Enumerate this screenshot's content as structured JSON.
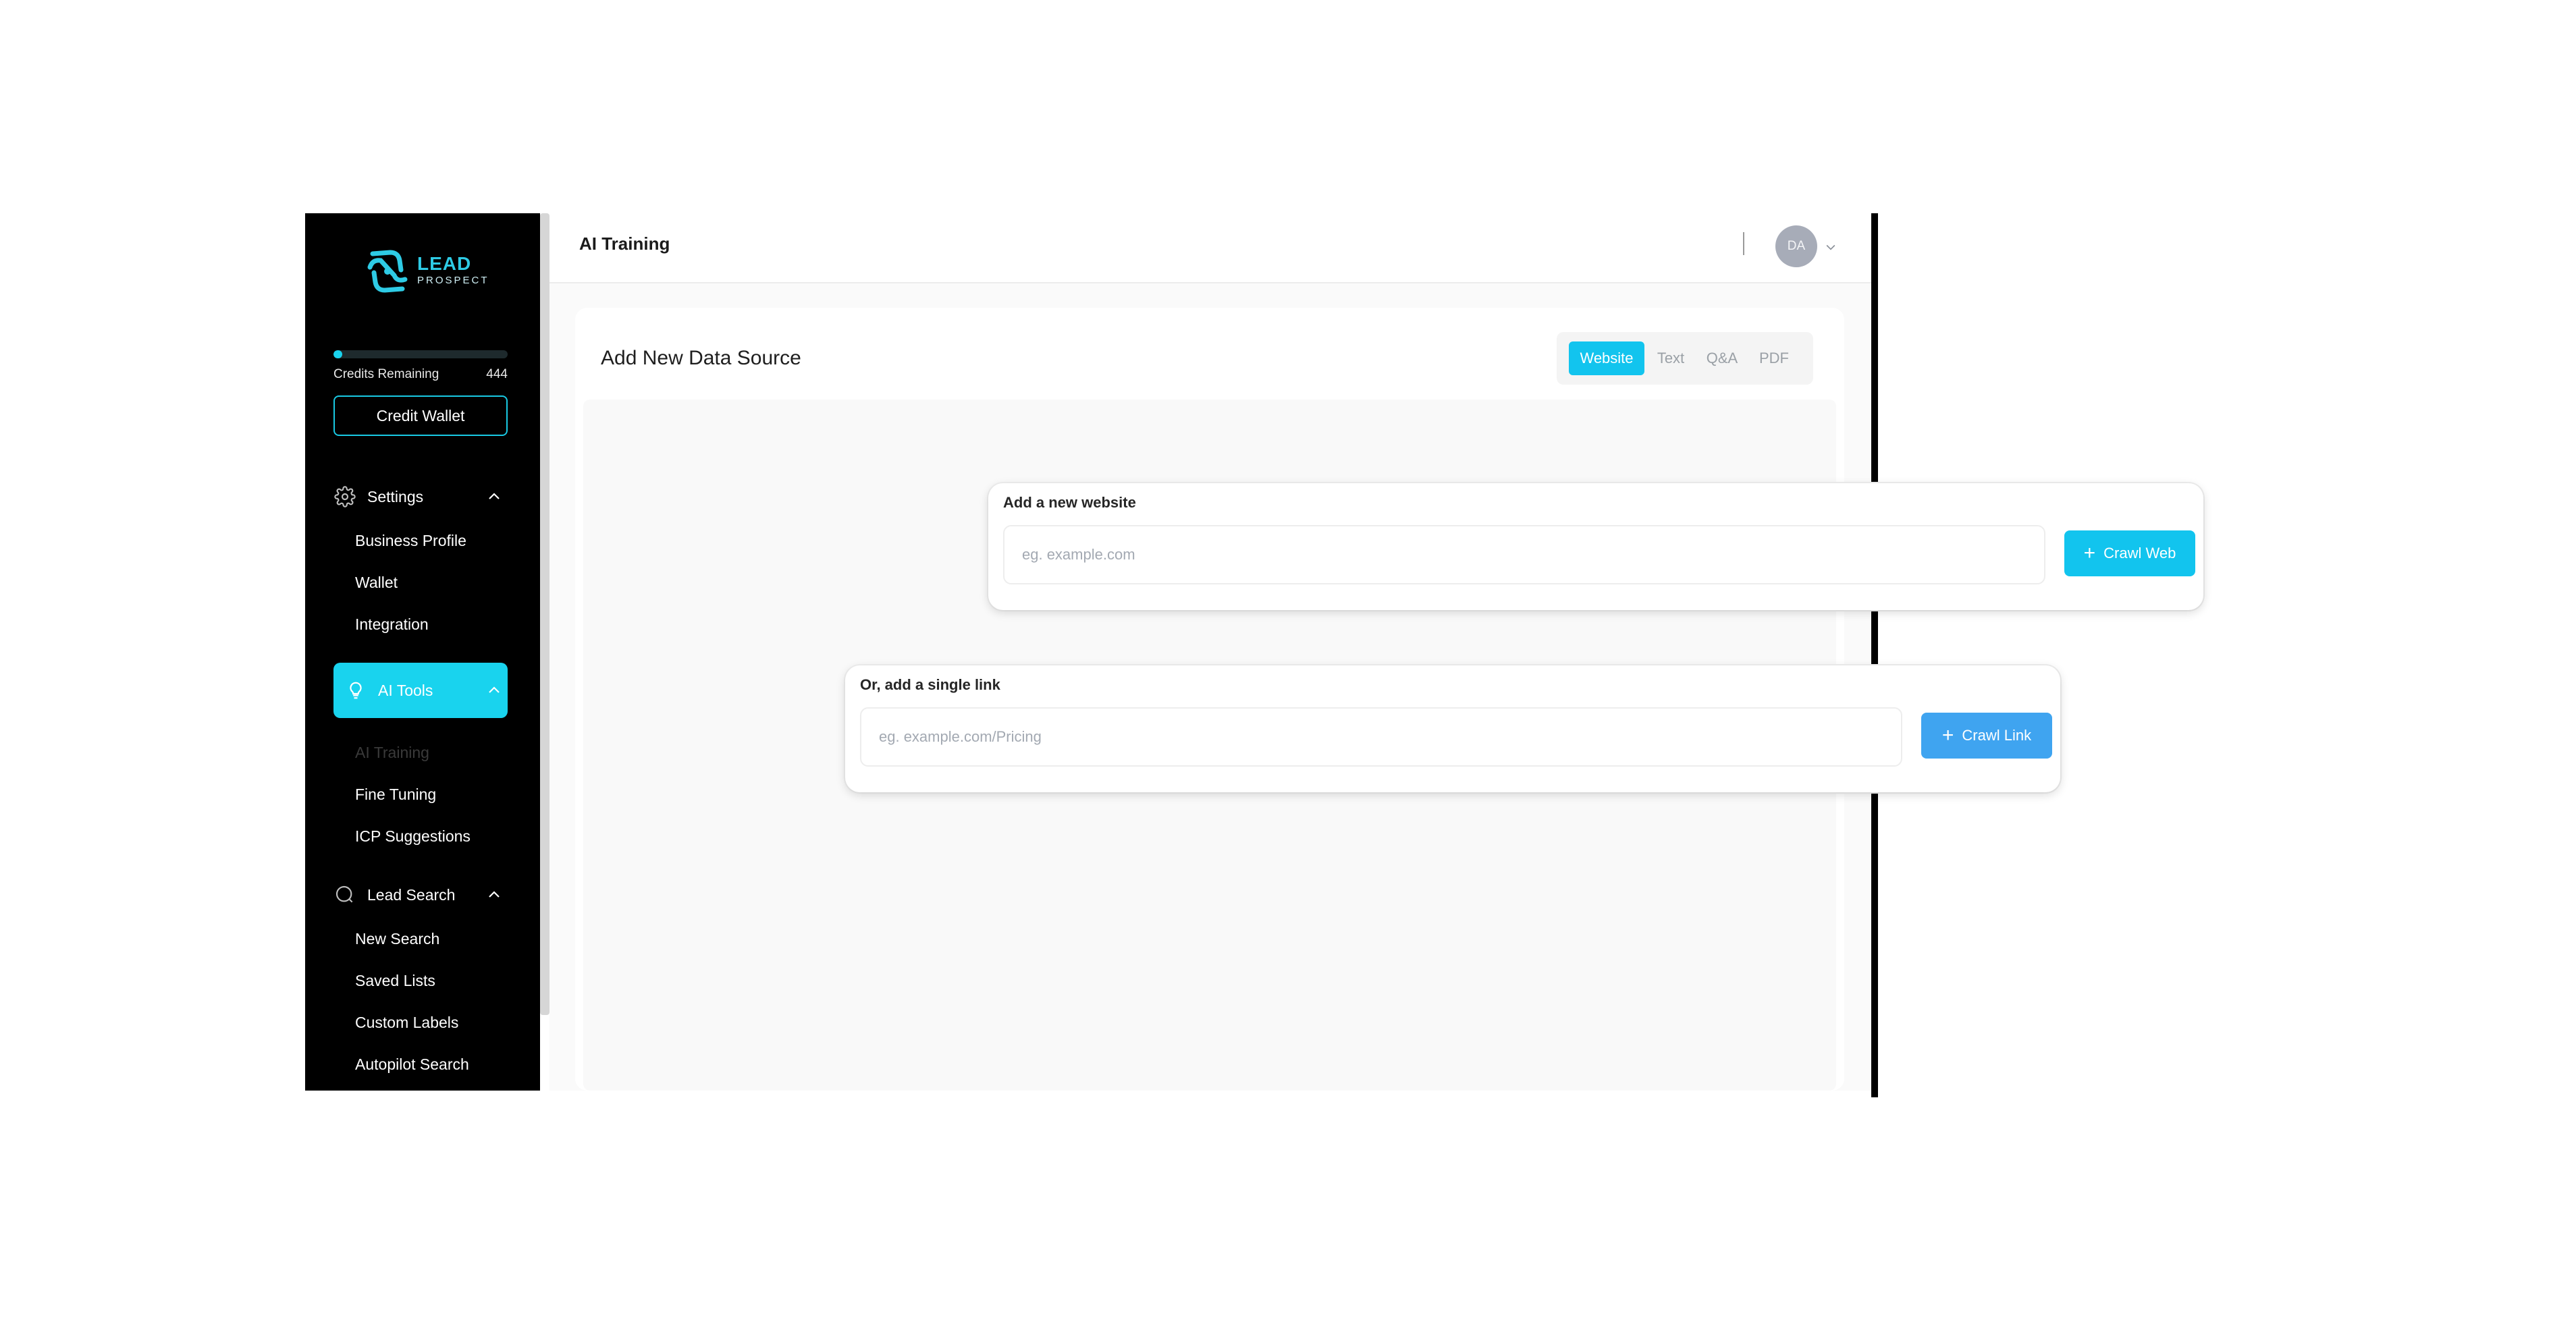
{
  "brand": {
    "name": "LEAD",
    "tagline": "PROSPECT",
    "accent": "#19d3ee"
  },
  "sidebar": {
    "credits": {
      "label": "Credits Remaining",
      "value": "444",
      "fill_fraction": 0.05
    },
    "wallet_button": "Credit Wallet",
    "sections": [
      {
        "label": "Settings",
        "icon": "gear-icon",
        "items": [
          "Business Profile",
          "Wallet",
          "Integration"
        ]
      },
      {
        "label": "AI Tools",
        "icon": "lightbulb-icon",
        "active": true,
        "items": [
          "AI Training",
          "Fine Tuning",
          "ICP Suggestions"
        ]
      },
      {
        "label": "Lead Search",
        "icon": "search-icon",
        "items": [
          "New Search",
          "Saved Lists",
          "Custom Labels",
          "Autopilot Search"
        ]
      }
    ]
  },
  "header": {
    "title": "AI Training",
    "avatar_initials": "DA"
  },
  "card": {
    "title": "Add New Data Source",
    "tabs": [
      "Website",
      "Text",
      "Q&A",
      "PDF"
    ],
    "active_tab": "Website"
  },
  "website_panel": {
    "label": "Add a new website",
    "placeholder": "eg. example.com",
    "button": "Crawl Web",
    "button_color": "#12c4ee"
  },
  "link_panel": {
    "label": "Or, add a single link",
    "placeholder": "eg. example.com/Pricing",
    "button": "Crawl Link",
    "button_color": "#3fa4f0"
  }
}
